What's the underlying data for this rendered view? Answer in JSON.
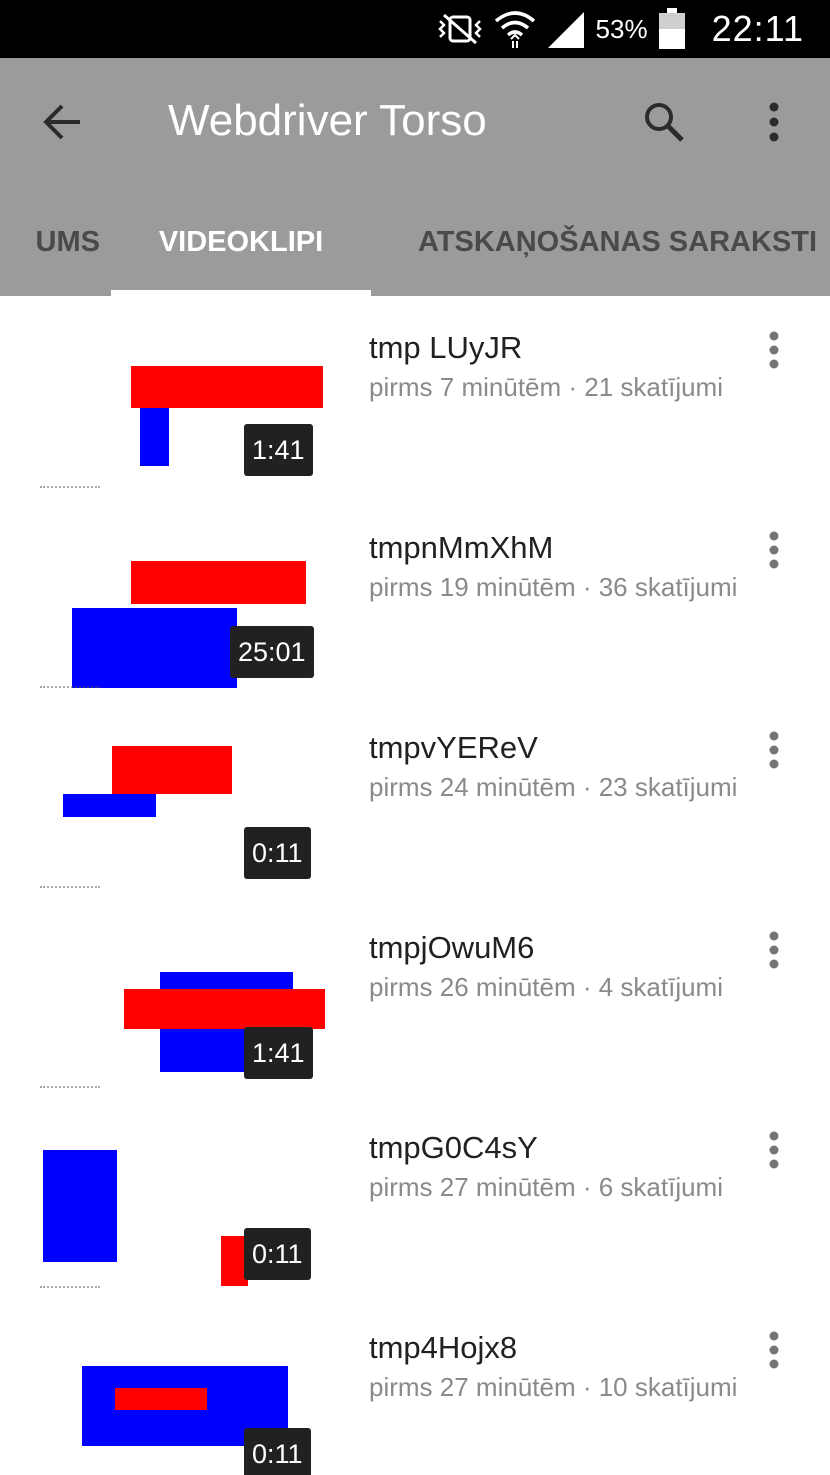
{
  "status_bar": {
    "battery_percent": "53%",
    "time": "22:11",
    "icons": [
      "vibrate-mute-icon",
      "wifi-icon",
      "signal-icon",
      "battery-icon"
    ]
  },
  "app_bar": {
    "title": "Webdriver Torso",
    "icons": [
      "back-arrow-icon",
      "search-icon",
      "more-vert-icon"
    ]
  },
  "tabs": [
    {
      "label": "UMS",
      "active": false
    },
    {
      "label": "VIDEOKLIPI",
      "active": true
    },
    {
      "label": "ATSKAŅOŠANAS SARAKSTI",
      "active": false
    }
  ],
  "colors": {
    "app_bar": "#9b9b9b",
    "thumb_red": "#ff0000",
    "thumb_blue": "#0000ff",
    "duration_bg": "#212121",
    "meta_text": "#8a8a8a"
  },
  "videos": [
    {
      "title": "tmp LUyJR",
      "meta": "pirms 7 minūtēm · 21 skatījumi",
      "duration": "1:41"
    },
    {
      "title": "tmpnMmXhM",
      "meta": "pirms 19 minūtēm · 36 skatījumi",
      "duration": "25:01"
    },
    {
      "title": "tmpvYEReV",
      "meta": "pirms 24 minūtēm · 23 skatījumi",
      "duration": "0:11"
    },
    {
      "title": "tmpjOwuM6",
      "meta": "pirms 26 minūtēm · 4 skatījumi",
      "duration": "1:41"
    },
    {
      "title": "tmpG0C4sY",
      "meta": "pirms 27 minūtēm · 6 skatījumi",
      "duration": "0:11"
    },
    {
      "title": "tmp4Hojx8",
      "meta": "pirms 27 minūtēm · 10 skatījumi",
      "duration": "0:11"
    }
  ]
}
